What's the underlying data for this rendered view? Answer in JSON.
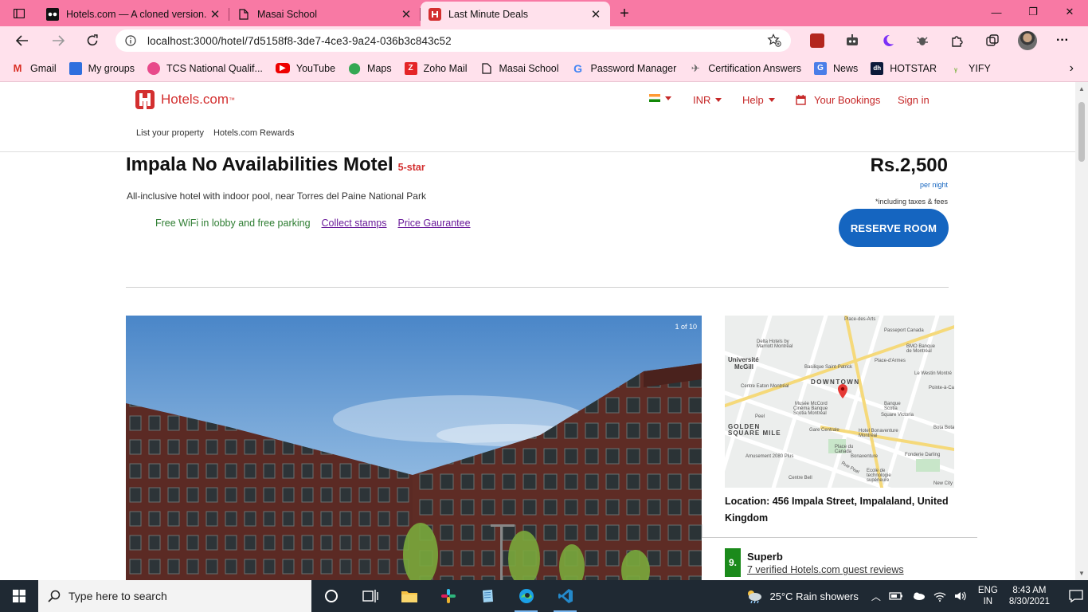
{
  "browser": {
    "tabs": [
      {
        "title": "Hotels.com — A cloned version.",
        "close": "✕",
        "active": false
      },
      {
        "title": "Masai School",
        "close": "✕",
        "active": false
      },
      {
        "title": "Last Minute Deals",
        "close": "✕",
        "active": true
      }
    ],
    "new_tab": "+",
    "window_controls": {
      "minimize": "—",
      "restore": "❐",
      "close": "✕"
    },
    "url": "localhost:3000/hotel/7d5158f8-3de7-4ce3-9a24-036b3c843c52",
    "bookmarks": [
      "Gmail",
      "My groups",
      "TCS National Qualif...",
      "YouTube",
      "Maps",
      "Zoho Mail",
      "Masai School",
      "Password Manager",
      "Certification Answers",
      "News",
      "HOTSTAR",
      "YIFY"
    ],
    "bookmarks_more": "›",
    "menu": "···"
  },
  "site": {
    "logo_text": "Hotels.com",
    "logo_tm": "™",
    "currency": "INR",
    "help": "Help",
    "bookings": "Your Bookings",
    "sign_in": "Sign in",
    "sublinks": [
      "List your property",
      "Hotels.com Rewards"
    ]
  },
  "hotel": {
    "name": "Impala No Availabilities Motel",
    "stars": "5-star",
    "description": "All-inclusive hotel with indoor pool, near Torres del Paine National Park",
    "features": {
      "wifi": "Free WiFi in lobby and free parking",
      "stamps": "Collect stamps",
      "guarantee": "Price Gaurantee"
    },
    "price": "Rs.2,500",
    "per_night": "per night",
    "taxes_note": "*including taxes & fees",
    "reserve_label": "RESERVE ROOM",
    "photo_counter": "1 of 10",
    "location": "Location: 456 Impala Street, Impalaland, United Kingdom",
    "rating_score": "9.",
    "rating_word": "Superb",
    "reviews": "7 verified Hotels.com guest reviews"
  },
  "map_labels": [
    "Place-des-Arts",
    "Université McGill",
    "DOWNTOWN",
    "Centre Eaton Montréal",
    "Musée McCord",
    "Passeport Canada",
    "Basilique Saint-Patrick",
    "Le Westin Montréal",
    "Pointe-à-Callière",
    "Cinéma Banque Scotia Montréal",
    "GOLDEN SQUARE MILE",
    "Gare Centrale",
    "Hotel Bonaventure Montreal",
    "Bonaventure",
    "Place du Canada",
    "Amusement 2080 Plus",
    "Centre Bell",
    "Fonderie Darling",
    "New City Gas",
    "Delta Hotels by Marriott Montreal",
    "Bota Bota",
    "Peel",
    "Banque Scotia",
    "BMO Banque de Montréal",
    "Place-d'Armes",
    "Square Victoria",
    "Ecole de technologie supérieure",
    "Rue Peel"
  ],
  "taskbar": {
    "search_placeholder": "Type here to search",
    "weather": "25°C  Rain showers",
    "lang_top": "ENG",
    "lang_bottom": "IN",
    "time": "8:43 AM",
    "date": "8/30/2021"
  },
  "colors": {
    "tabbar": "#f879a4",
    "chrome": "#ffe1ec",
    "brand_red": "#d32f2f",
    "reserve_blue": "#1565c0",
    "rating_green": "#1b8a1b"
  }
}
